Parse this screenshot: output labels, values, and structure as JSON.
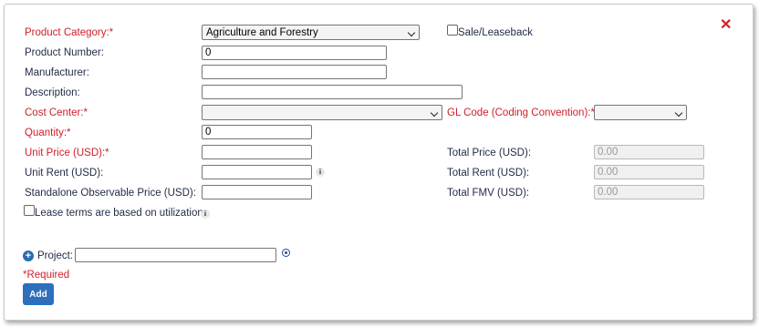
{
  "form": {
    "product_category_label": "Product Category:*",
    "product_category_value": "Agriculture and Forestry",
    "sale_leaseback_label": "Sale/Leaseback",
    "product_number_label": "Product Number:",
    "product_number_value": "0",
    "manufacturer_label": "Manufacturer:",
    "manufacturer_value": "",
    "description_label": "Description:",
    "description_value": "",
    "cost_center_label": "Cost Center:*",
    "cost_center_value": "",
    "gl_code_label": "GL Code (Coding Convention):*",
    "gl_code_value": "",
    "quantity_label": "Quantity:*",
    "quantity_value": "0",
    "unit_price_label": "Unit Price (USD):*",
    "unit_price_value": "",
    "unit_rent_label": "Unit Rent (USD):",
    "unit_rent_value": "",
    "standalone_label": "Standalone Observable Price (USD):",
    "standalone_value": "",
    "total_price_label": "Total Price (USD):",
    "total_price_value": "0.00",
    "total_rent_label": "Total Rent (USD):",
    "total_rent_value": "0.00",
    "total_fmv_label": "Total FMV (USD):",
    "total_fmv_value": "0.00",
    "lease_terms_label": "Lease terms are based on utilization",
    "project_label": "Project:",
    "project_value": "",
    "required_note": "*Required",
    "add_button": "Add"
  },
  "icons": {
    "close": "close-icon",
    "info": "info-icon",
    "expand": "plus-circle-icon",
    "lookup": "target-icon"
  },
  "colors": {
    "required": "#d0202a",
    "accent": "#2d6fbd",
    "text": "#1f2a44"
  }
}
